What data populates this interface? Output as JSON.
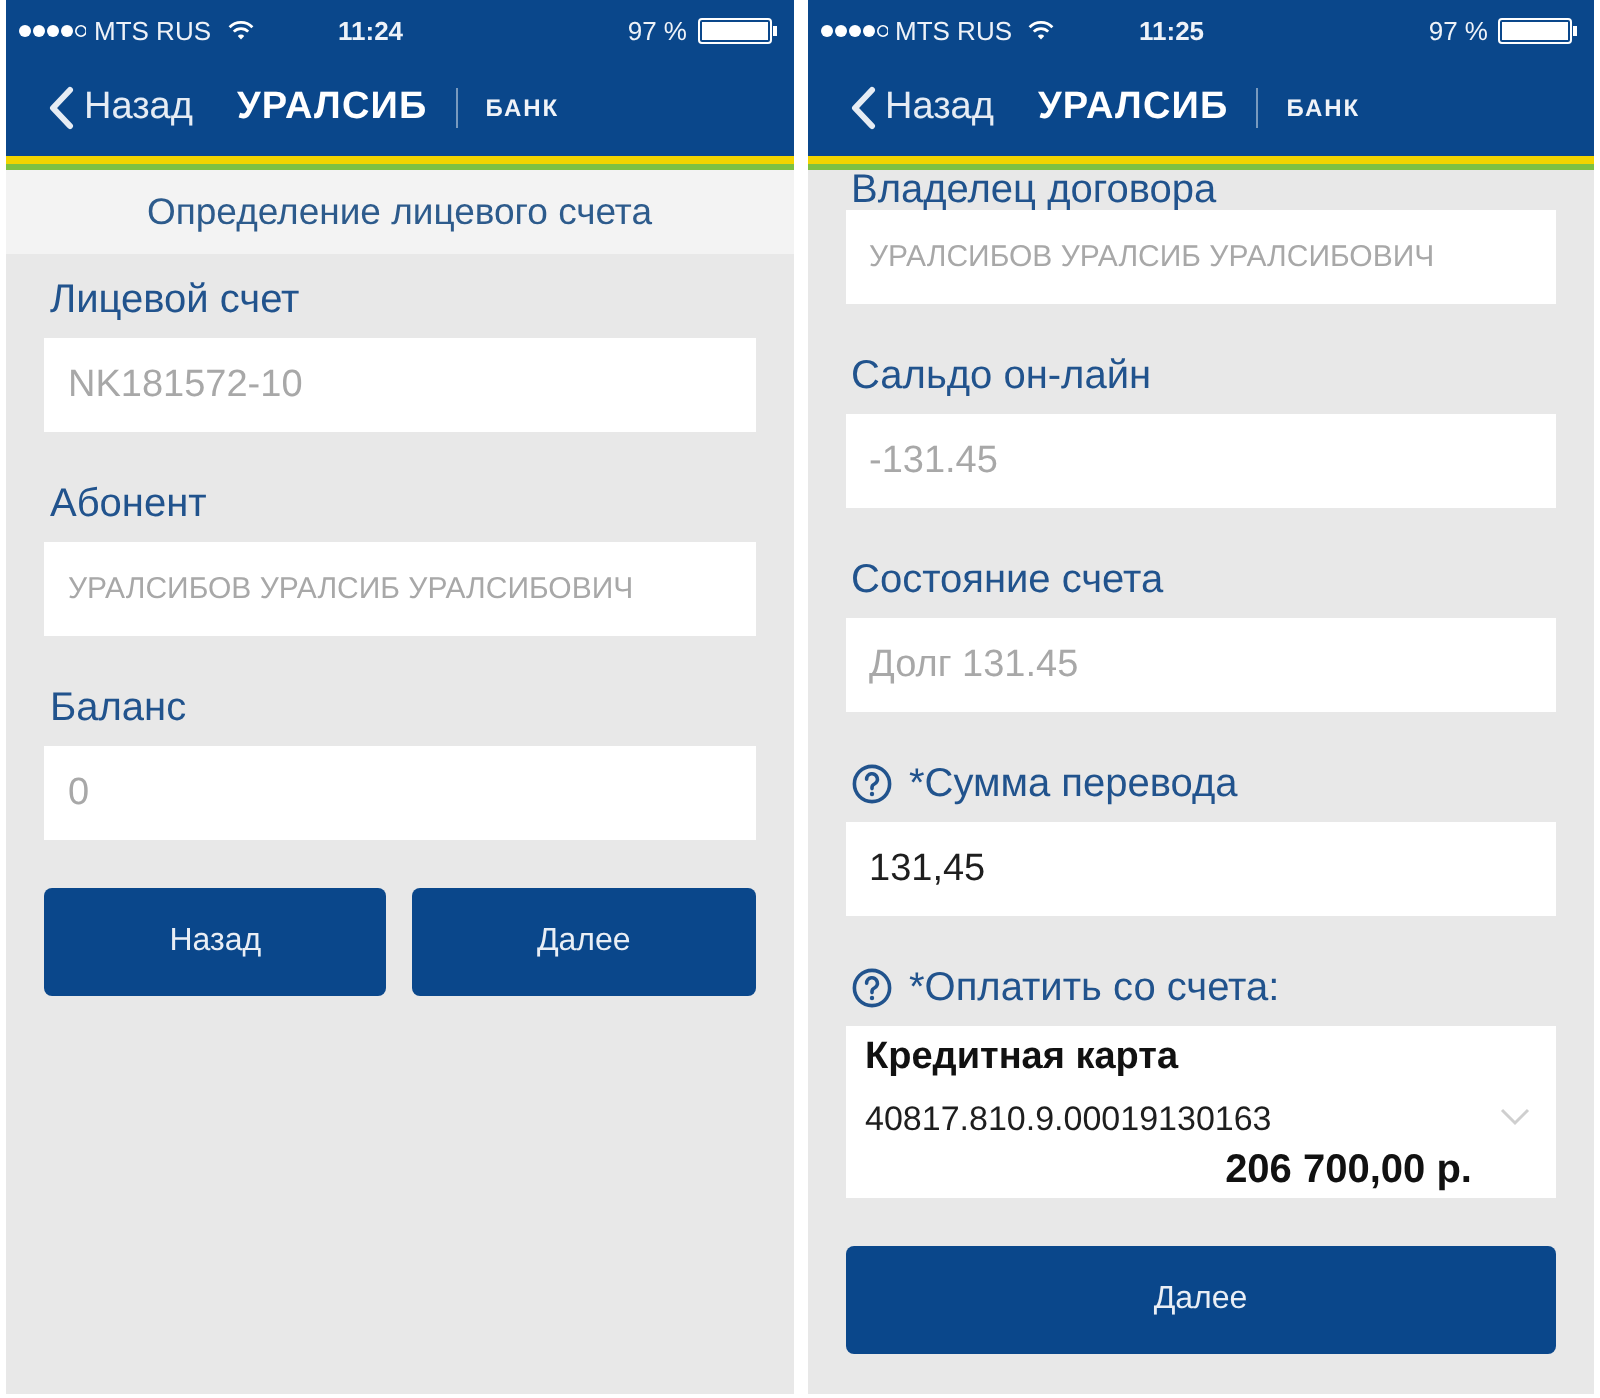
{
  "screens": [
    {
      "status_bar": {
        "carrier": "MTS RUS",
        "time": "11:24",
        "battery": "97 %"
      },
      "nav_bar": {
        "back": "Назад",
        "logo": "УРАЛСИБ",
        "logo_suffix": "БАНК"
      },
      "subtitle": "Определение лицевого счета",
      "fields": [
        {
          "kind": "text",
          "label": "Лицевой счет",
          "value": "NK181572-10",
          "disabled": true,
          "help": false
        },
        {
          "kind": "text",
          "label": "Абонент",
          "value": "УРАЛСИБОВ УРАЛСИБ УРАЛСИБОВИЧ",
          "disabled": true,
          "help": false
        },
        {
          "kind": "text",
          "label": "Баланс",
          "value": "0",
          "disabled": true,
          "help": false
        }
      ],
      "buttons": [
        "Назад",
        "Далее"
      ]
    },
    {
      "status_bar": {
        "carrier": "MTS RUS",
        "time": "11:25",
        "battery": "97 %"
      },
      "nav_bar": {
        "back": "Назад",
        "logo": "УРАЛСИБ",
        "logo_suffix": "БАНК"
      },
      "fields": [
        {
          "kind": "text",
          "label": "Владелец договора",
          "value": "УРАЛСИБОВ УРАЛСИБ УРАЛСИБОВИЧ",
          "disabled": true,
          "help": false
        },
        {
          "kind": "text",
          "label": "Сальдо он-лайн",
          "value": "-131.45",
          "disabled": true,
          "help": false
        },
        {
          "kind": "text",
          "label": "Состояние счета",
          "value": "Долг 131.45",
          "disabled": true,
          "help": false
        },
        {
          "kind": "text",
          "label": "*Сумма перевода",
          "value": "131,45",
          "disabled": false,
          "help": true
        },
        {
          "kind": "select",
          "label": "*Оплатить со счета:",
          "help": true,
          "account_name": "Кредитная карта",
          "account_number": "40817.810.9.00019130163",
          "balance": "206 700,00 р."
        }
      ],
      "buttons": [
        "Далее"
      ]
    }
  ]
}
